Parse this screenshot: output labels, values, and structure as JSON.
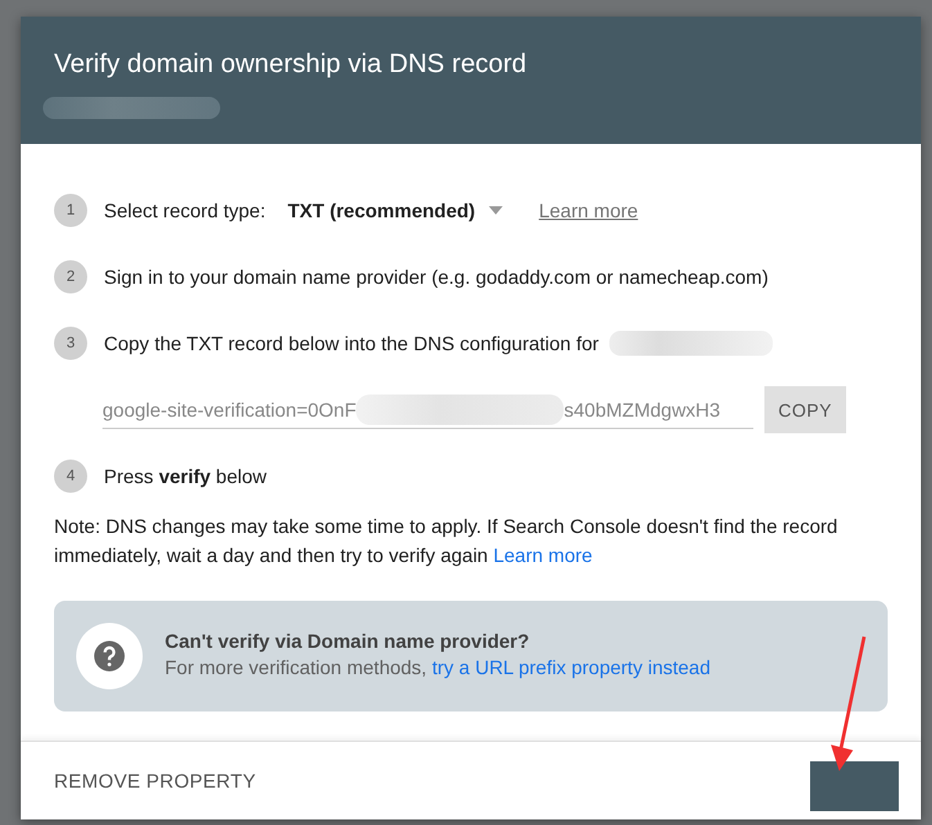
{
  "dialog": {
    "title": "Verify domain ownership via DNS record",
    "subtitle_redacted": true
  },
  "steps": [
    {
      "number": "1",
      "kind": "select",
      "label": "Select record type:",
      "value": "TXT (recommended)",
      "link": "Learn more"
    },
    {
      "number": "2",
      "kind": "text",
      "label": "Sign in to your domain name provider (e.g. godaddy.com or namecheap.com)"
    },
    {
      "number": "3",
      "kind": "record",
      "label": "Copy the TXT record below into the DNS configuration for",
      "record_start": "google-site-verification=0OnF",
      "record_end": "s40bMZMdgwxH3",
      "copy_button": "COPY"
    },
    {
      "number": "4",
      "kind": "text",
      "label": "Press **verify** below"
    }
  ],
  "note": {
    "text": "Note: DNS changes may take some time to apply. If Search Console doesn't find the record immediately, wait a day and then try to verify again",
    "link": "Learn more"
  },
  "help_box": {
    "title": "Can't verify via Domain name provider?",
    "text": "For more verification methods,",
    "link": "try a URL prefix property instead"
  },
  "footer": {
    "remove_button": "REMOVE PROPERTY"
  }
}
